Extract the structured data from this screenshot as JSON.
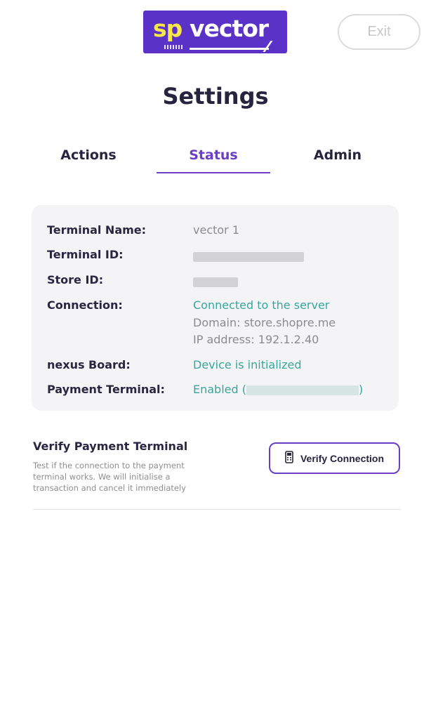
{
  "brand": {
    "logo_sp": "sp",
    "logo_vector": "vector",
    "brand_color": "#5b32c8",
    "sp_color": "#f6e74a"
  },
  "header": {
    "exit_label": "Exit"
  },
  "page": {
    "title": "Settings"
  },
  "tabs": [
    {
      "label": "Actions",
      "active": false
    },
    {
      "label": "Status",
      "active": true
    },
    {
      "label": "Admin",
      "active": false
    }
  ],
  "status": {
    "terminal_name_label": "Terminal Name:",
    "terminal_name_value": "vector 1",
    "terminal_id_label": "Terminal ID:",
    "store_id_label": "Store ID:",
    "connection_label": "Connection:",
    "connection_value": "Connected to the server",
    "domain_value": "Domain: store.shopre.me",
    "ip_value": "IP address: 192.1.2.40",
    "nexus_label": "nexus Board:",
    "nexus_value": "Device is initialized",
    "payment_label": "Payment Terminal:",
    "payment_value_prefix": "Enabled (",
    "payment_value_suffix": ")"
  },
  "verify": {
    "title": "Verify Payment Terminal",
    "description": "Test if the connection to the payment terminal works. We will initialise a transaction and cancel it immediately",
    "button_label": "Verify Connection",
    "button_icon": "payment-terminal-icon"
  },
  "colors": {
    "accent": "#6a3fc3",
    "success": "#37a69b",
    "card_bg": "#f4f4f6"
  }
}
